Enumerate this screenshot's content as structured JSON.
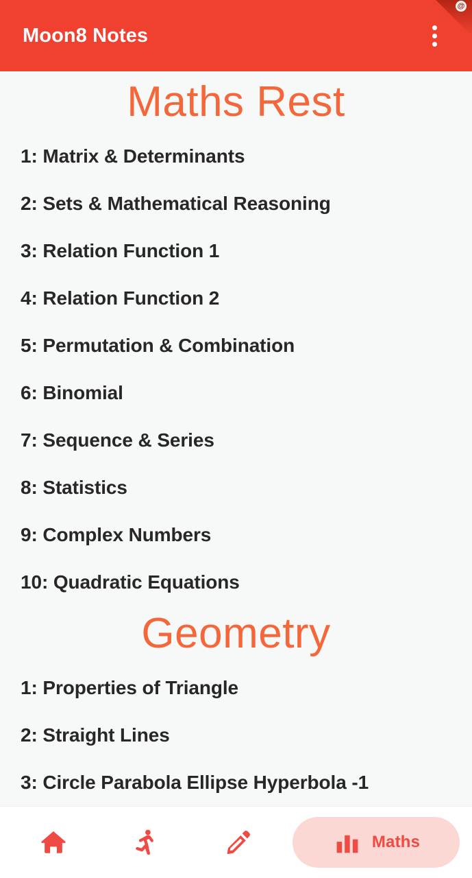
{
  "app": {
    "title": "Moon8 Notes",
    "accent_color": "#f04130",
    "heading_color": "#f4673a",
    "body_bg": "#f7f8f8",
    "text_color": "#272727",
    "active_pill_bg": "#fbd8d4",
    "nav_icon_color": "#ef4b44"
  },
  "appbar": {
    "title": "Moon8 Notes",
    "overflow_icon": "more-vert-icon",
    "corner_glyph": "@"
  },
  "sections": [
    {
      "heading": "Maths Rest",
      "items": [
        "1: Matrix & Determinants",
        "2: Sets & Mathematical Reasoning",
        "3: Relation Function 1",
        "4: Relation Function 2",
        "5: Permutation & Combination",
        "6: Binomial",
        "7: Sequence & Series",
        "8: Statistics",
        "9: Complex Numbers",
        "10: Quadratic Equations"
      ]
    },
    {
      "heading": "Geometry",
      "items": [
        "1: Properties of Triangle",
        "2: Straight Lines",
        "3: Circle Parabola Ellipse Hyperbola -1"
      ]
    }
  ],
  "bottom_nav": {
    "items": [
      {
        "icon": "home-icon",
        "label": "",
        "active": false
      },
      {
        "icon": "running-person-icon",
        "label": "",
        "active": false
      },
      {
        "icon": "pencil-icon",
        "label": "",
        "active": false
      },
      {
        "icon": "bar-chart-icon",
        "label": "Maths",
        "active": true
      }
    ]
  }
}
